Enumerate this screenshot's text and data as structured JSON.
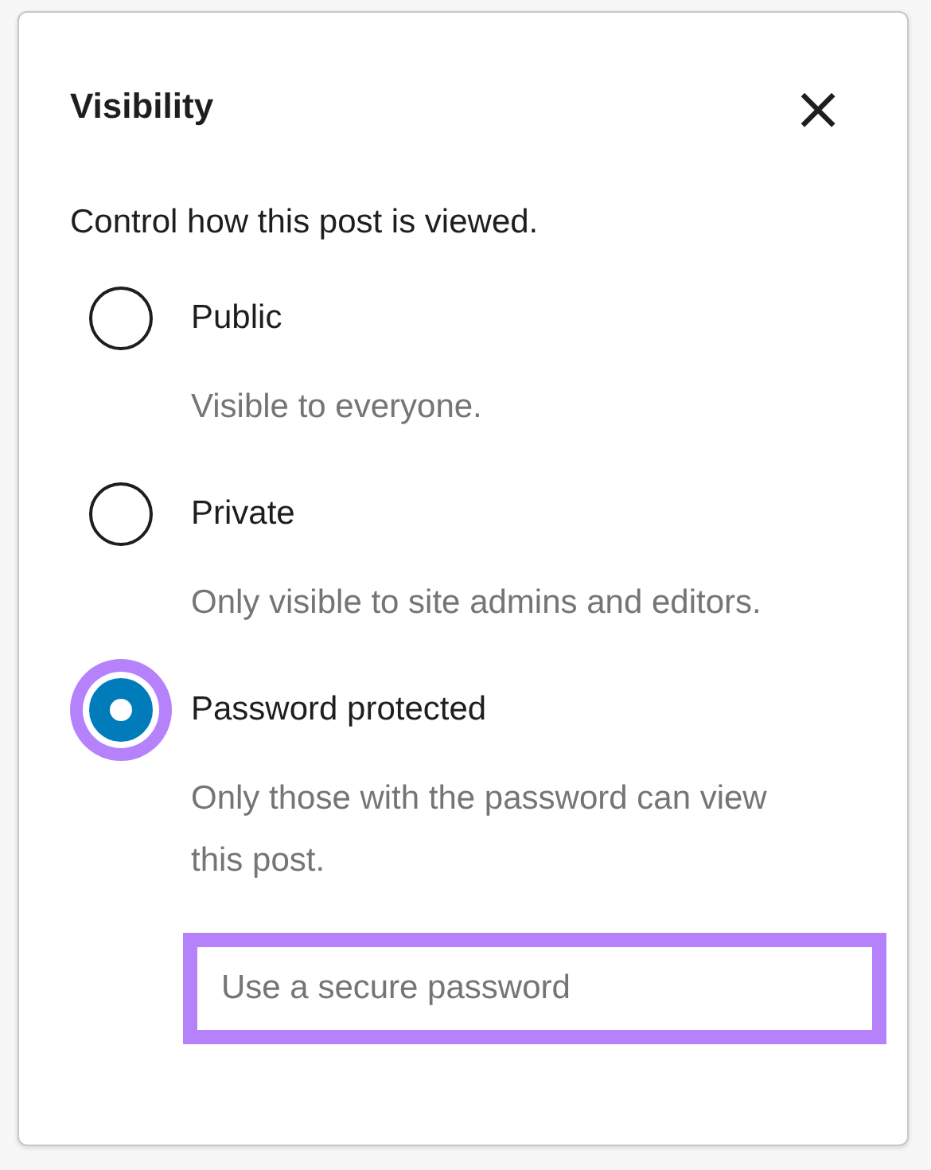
{
  "popover": {
    "title": "Visibility",
    "close": "×",
    "description": "Control how this post is viewed."
  },
  "options": [
    {
      "label": "Public",
      "help": "Visible to everyone.",
      "selected": false,
      "focused": false
    },
    {
      "label": "Private",
      "help": "Only visible to site admins and editors.",
      "selected": false,
      "focused": false
    },
    {
      "label": "Password protected",
      "help": "Only those with the password can view this post.",
      "selected": true,
      "focused": true
    }
  ],
  "password_field": {
    "placeholder": "Use a secure password",
    "focused": true
  }
}
